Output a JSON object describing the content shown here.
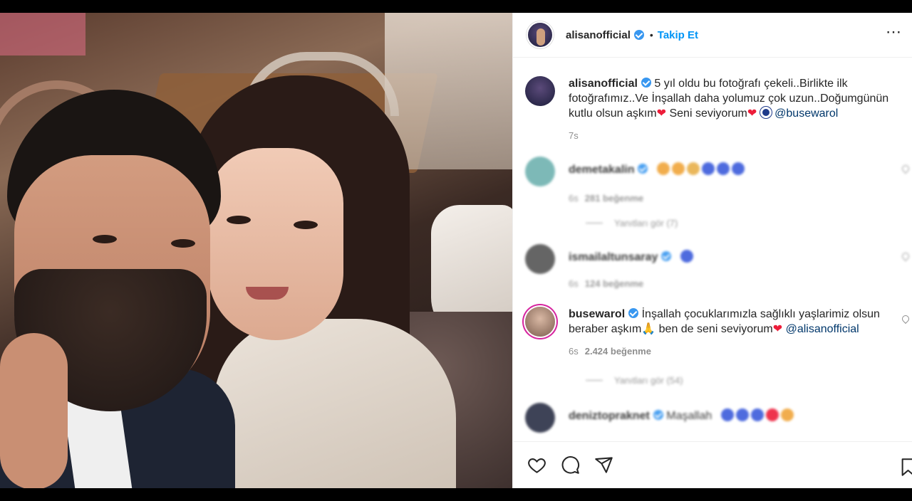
{
  "post": {
    "username": "alisanofficial",
    "follow_label": "Takip Et",
    "dot": "•",
    "more": "⋯",
    "caption": {
      "username": "alisanofficial",
      "text_1": "5 yıl oldu bu fotoğrafı çekeli..Birlikte ilk fotoğrafımız..Ve İnşallah daha yolumuz çok uzun..Doğumgünün kutlu olsun aşkım",
      "heart": "❤",
      "text_2": "Seni seviyorum",
      "mention": "@busewarol",
      "time": "7s"
    }
  },
  "comments": [
    {
      "username": "demetakalin",
      "text": "",
      "time": "6s",
      "likes": "281 beğenme",
      "replies": "Yanıtları gör (7)",
      "avatar_color": "#6fb2b0",
      "emoji_colors": [
        "#f0a53a",
        "#f0a53a",
        "#e8b04a",
        "#3b5bdb",
        "#3b5bdb",
        "#3b5bdb"
      ]
    },
    {
      "username": "ismailaltunsaray",
      "text": "",
      "time": "6s",
      "likes": "124 beğenme",
      "replies": "",
      "avatar_color": "#555555",
      "emoji_colors": [
        "#3b5bdb"
      ]
    },
    {
      "username": "busewarol",
      "text_1": "İnşallah çocuklarımızla sağlıklı yaşlarimiz olsun beraber aşkım",
      "pray": "🙏",
      "text_2": "ben de seni seviyorum",
      "heart": "❤",
      "mention": "@alisanofficial",
      "time": "6s",
      "likes": "2.424 beğenme",
      "replies": "Yanıtları gör (54)",
      "avatar_color": "#b68c7a"
    },
    {
      "username": "deniztopraknet",
      "text": "Maşallah",
      "avatar_color": "#2a2f45",
      "emoji_colors": [
        "#3b5bdb",
        "#3b5bdb",
        "#3b5bdb",
        "#ed1d3a",
        "#f0a53a"
      ]
    }
  ],
  "colors": {
    "follow": "#0095f6",
    "verified": "#3897f0",
    "mention": "#00376b"
  }
}
